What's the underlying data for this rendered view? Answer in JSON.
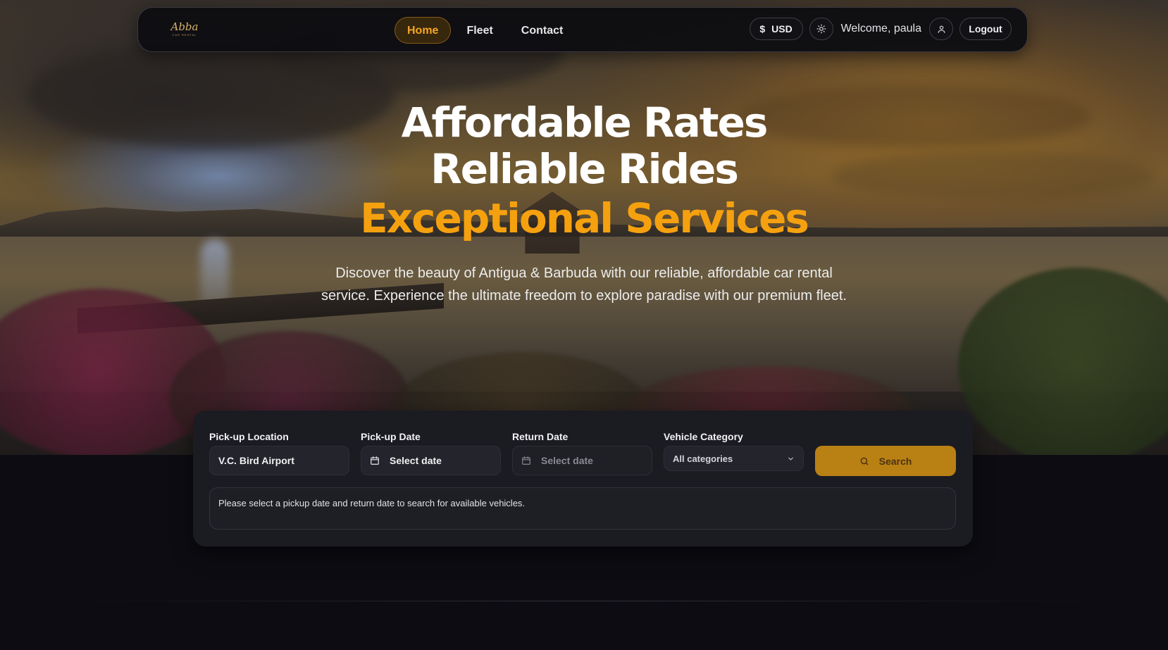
{
  "brand": {
    "logo_text": "Abba",
    "logo_sub": "CAR RENTAL"
  },
  "nav": {
    "links": [
      {
        "label": "Home",
        "active": true
      },
      {
        "label": "Fleet",
        "active": false
      },
      {
        "label": "Contact",
        "active": false
      }
    ],
    "currency": "USD",
    "currency_symbol": "$",
    "welcome": "Welcome, paula",
    "logout": "Logout"
  },
  "hero": {
    "line1": "Affordable Rates",
    "line2": "Reliable Rides",
    "line3": "Exceptional Services",
    "subtitle": "Discover the beauty of Antigua & Barbuda with our reliable, affordable car rental service. Experience the ultimate freedom to explore paradise with our premium fleet."
  },
  "search": {
    "pickup_location_label": "Pick-up Location",
    "pickup_location_value": "V.C. Bird Airport",
    "pickup_date_label": "Pick-up Date",
    "pickup_date_placeholder": "Select date",
    "return_date_label": "Return Date",
    "return_date_placeholder": "Select date",
    "category_label": "Vehicle Category",
    "category_value": "All categories",
    "search_label": "Search",
    "notice": "Please select a pickup date and return date to search for available vehicles."
  },
  "icons": {
    "currency": "dollar-icon",
    "theme": "sun-icon",
    "account": "user-icon",
    "calendar": "calendar-icon",
    "chevron": "chevron-down-icon",
    "search": "search-icon"
  },
  "colors": {
    "accent": "#f5a10f",
    "search_button": "#b98014",
    "panel": "#1b1b22",
    "page_bg": "#0c0c12"
  }
}
